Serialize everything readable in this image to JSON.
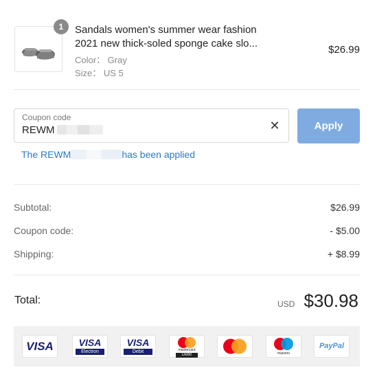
{
  "cart": {
    "item": {
      "quantity": "1",
      "title": "Sandals women's summer wear fashion 2021 new thick-soled sponge cake slo...",
      "color_label": "Color： Gray",
      "size_label": "Size： US 5",
      "price": "$26.99"
    }
  },
  "coupon": {
    "label": "Coupon code",
    "value_visible": "REWM",
    "clear_icon": "close-icon",
    "apply_label": "Apply",
    "applied_prefix": "The REWM",
    "applied_suffix": "has been applied"
  },
  "summary": {
    "subtotal_label": "Subtotal:",
    "subtotal_value": "$26.99",
    "coupon_label": "Coupon code:",
    "coupon_value": "- $5.00",
    "shipping_label": "Shipping:",
    "shipping_value": "+ $8.99"
  },
  "total": {
    "label": "Total:",
    "currency": "USD",
    "amount": "$30.98"
  },
  "payment_methods": {
    "visa": "VISA",
    "visa_electron": "VISA",
    "visa_electron_sub": "Electron",
    "visa_debit": "VISA",
    "visa_debit_sub": "Debit",
    "mastercard_debit_text": "mastercard",
    "mastercard_debit_sub": "Debit",
    "maestro_text": "maestro",
    "paypal": "PayPal"
  },
  "colors": {
    "apply_button": "#7fabe0",
    "link_blue": "#2f78c4",
    "visa_blue": "#1a1f71",
    "mc_red": "#eb001b",
    "mc_orange": "#f79e1b",
    "maestro_blue": "#0099df"
  }
}
